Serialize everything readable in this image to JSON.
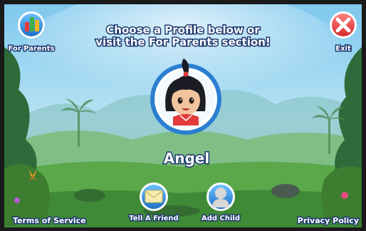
{
  "heading": {
    "line1": "Choose a Profile below or",
    "line2": "visit the For Parents section!"
  },
  "header": {
    "for_parents_label": "For Parents",
    "exit_label": "Exit"
  },
  "profiles": [
    {
      "name": "Angel"
    }
  ],
  "footer": {
    "terms_label": "Terms of Service",
    "tell_friend_label": "Tell A Friend",
    "add_child_label": "Add Child",
    "privacy_label": "Privacy Policy"
  },
  "icons": {
    "for_parents": "bar-chart-icon",
    "exit": "close-icon",
    "tell_friend": "envelope-icon",
    "add_child": "child-silhouette-icon",
    "profile": "girl-avatar-icon"
  },
  "colors": {
    "button_blue": "#2f86d6",
    "exit_red": "#e83a3a",
    "text_outline": "#1f3a70"
  }
}
